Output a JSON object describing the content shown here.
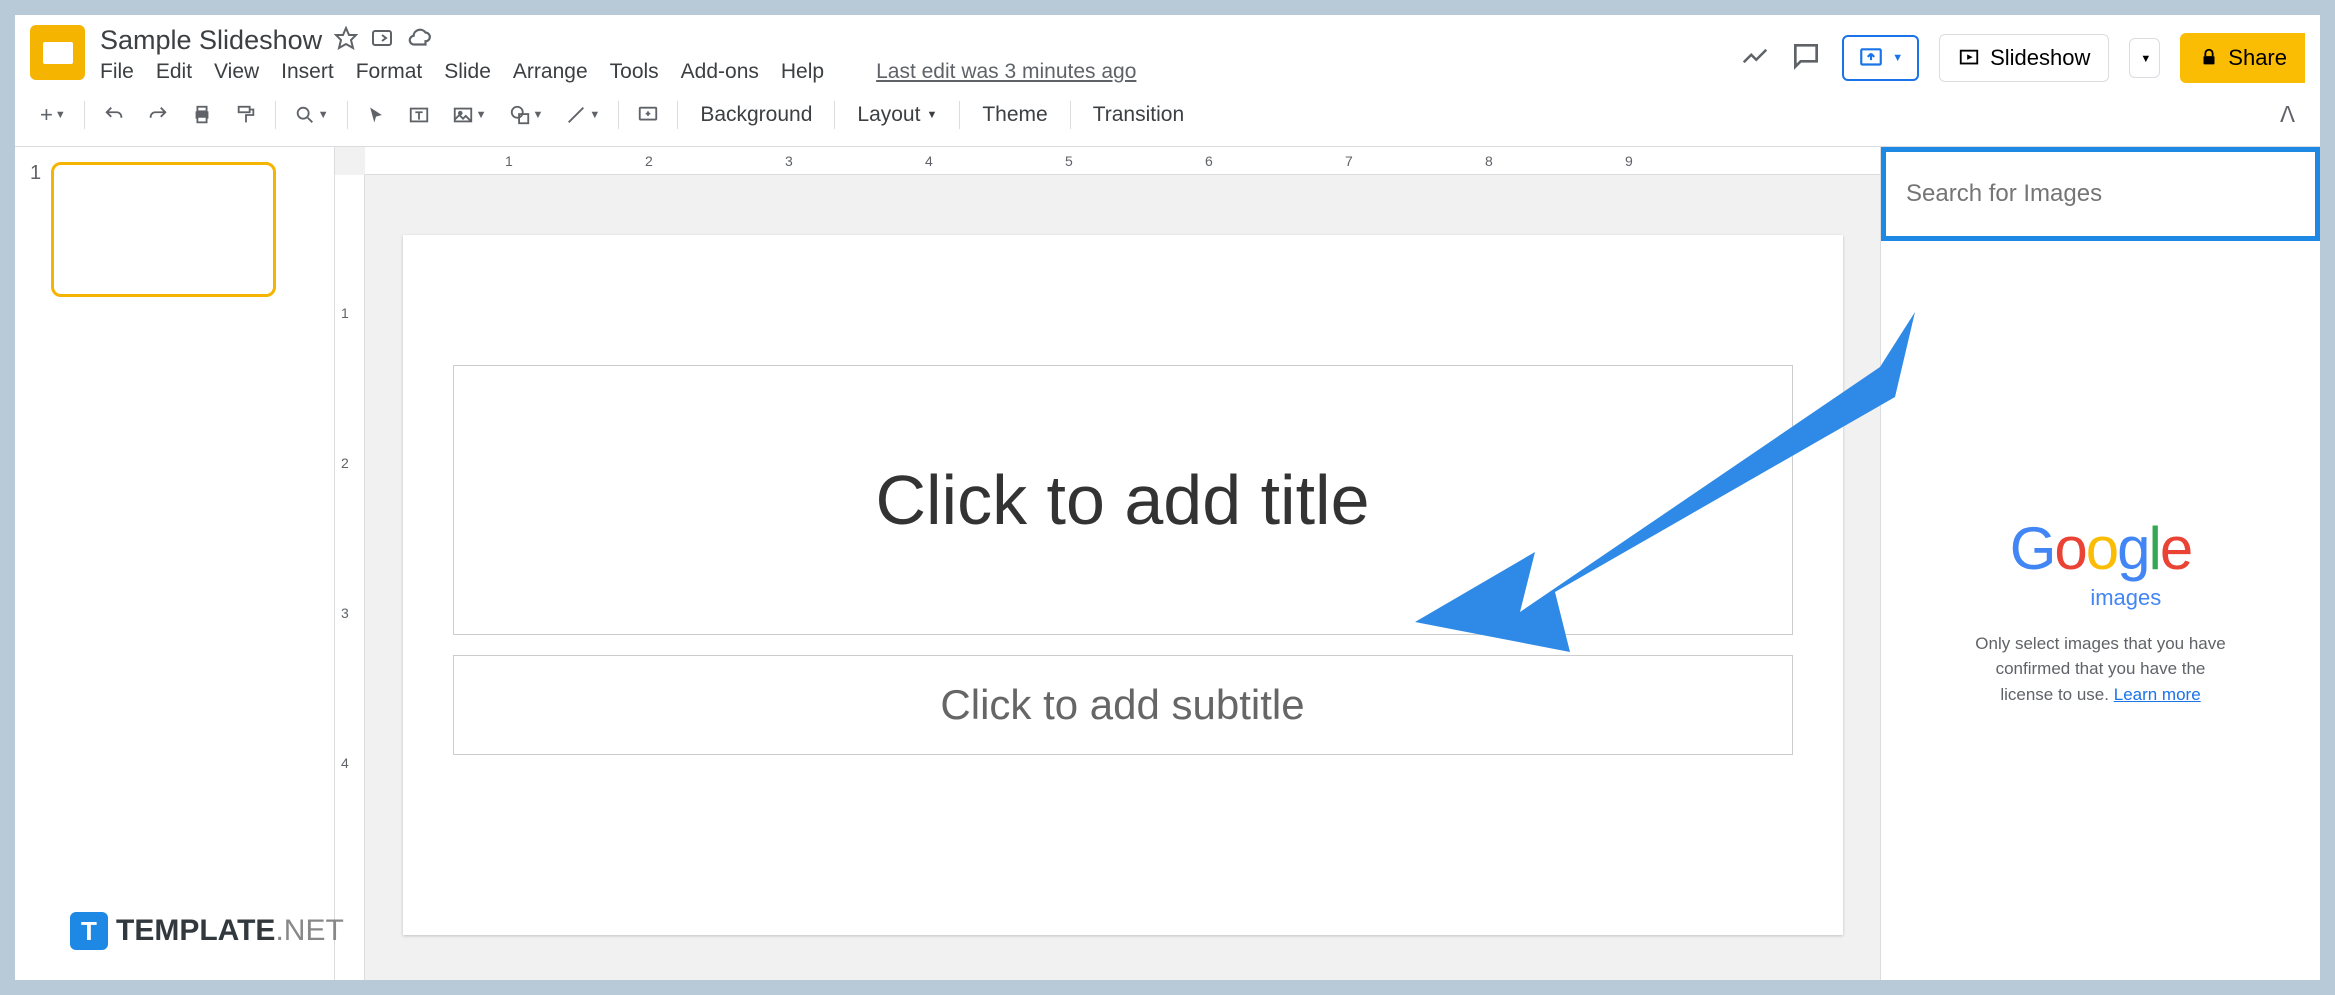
{
  "doc": {
    "title": "Sample Slideshow",
    "last_edit": "Last edit was 3 minutes ago"
  },
  "menu": {
    "file": "File",
    "edit": "Edit",
    "view": "View",
    "insert": "Insert",
    "format": "Format",
    "slide": "Slide",
    "arrange": "Arrange",
    "tools": "Tools",
    "addons": "Add-ons",
    "help": "Help"
  },
  "header": {
    "slideshow": "Slideshow",
    "share": "Share"
  },
  "toolbar": {
    "background": "Background",
    "layout": "Layout",
    "theme": "Theme",
    "transition": "Transition"
  },
  "thumb": {
    "num": "1"
  },
  "slide": {
    "title_ph": "Click to add title",
    "subtitle_ph": "Click to add subtitle"
  },
  "side": {
    "search_placeholder": "Search for Images",
    "images": "images",
    "disclaimer_l1": "Only select images that you have",
    "disclaimer_l2": "confirmed that you have the",
    "disclaimer_l3": "license to use.",
    "learn": "Learn more"
  },
  "ruler": {
    "r1": "1",
    "r2": "2",
    "r3": "3",
    "r4": "4",
    "r5": "5",
    "r6": "6",
    "r7": "7",
    "r8": "8",
    "r9": "9",
    "v1": "1",
    "v2": "2",
    "v3": "3",
    "v4": "4"
  },
  "watermark": {
    "t": "TEMPLATE",
    "net": ".NET"
  }
}
